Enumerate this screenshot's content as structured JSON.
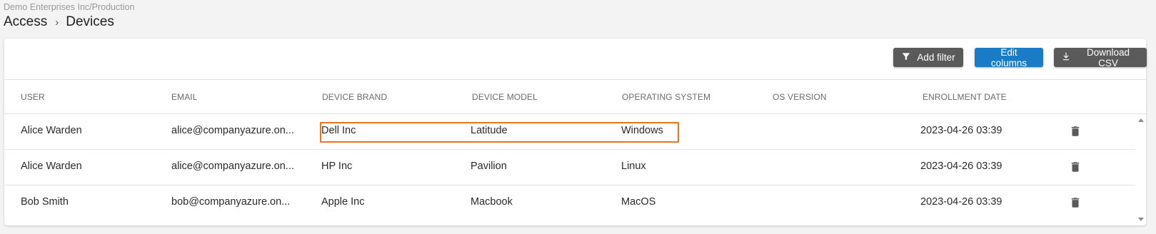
{
  "header": {
    "org_path": "Demo Enterprises Inc/Production",
    "breadcrumb": {
      "parent": "Access",
      "separator": "›",
      "current": "Devices"
    }
  },
  "toolbar": {
    "add_filter_label": "Add filter",
    "edit_columns_label": "Edit columns",
    "download_csv_label": "Download CSV"
  },
  "table": {
    "columns": [
      "USER",
      "EMAIL",
      "DEVICE BRAND",
      "DEVICE MODEL",
      "OPERATING SYSTEM",
      "OS VERSION",
      "ENROLLMENT DATE"
    ],
    "rows": [
      {
        "user": "Alice Warden",
        "email": "alice@companyazure.on...",
        "brand": "Dell Inc",
        "model": "Latitude",
        "os": "Windows",
        "os_version": "",
        "enrollment": "2023-04-26 03:39"
      },
      {
        "user": "Alice Warden",
        "email": "alice@companyazure.on...",
        "brand": "HP Inc",
        "model": "Pavilion",
        "os": "Linux",
        "os_version": "",
        "enrollment": "2023-04-26 03:39"
      },
      {
        "user": "Bob Smith",
        "email": "bob@companyazure.on...",
        "brand": "Apple Inc",
        "model": "Macbook",
        "os": "MacOS",
        "os_version": "",
        "enrollment": "2023-04-26 03:39"
      }
    ]
  },
  "colors": {
    "accent_blue": "#1a7cc7",
    "button_gray": "#5a5a5a",
    "highlight_orange": "#e8761f"
  },
  "icons": {
    "filter": "filter-icon",
    "download": "download-icon",
    "delete": "trash-icon"
  }
}
